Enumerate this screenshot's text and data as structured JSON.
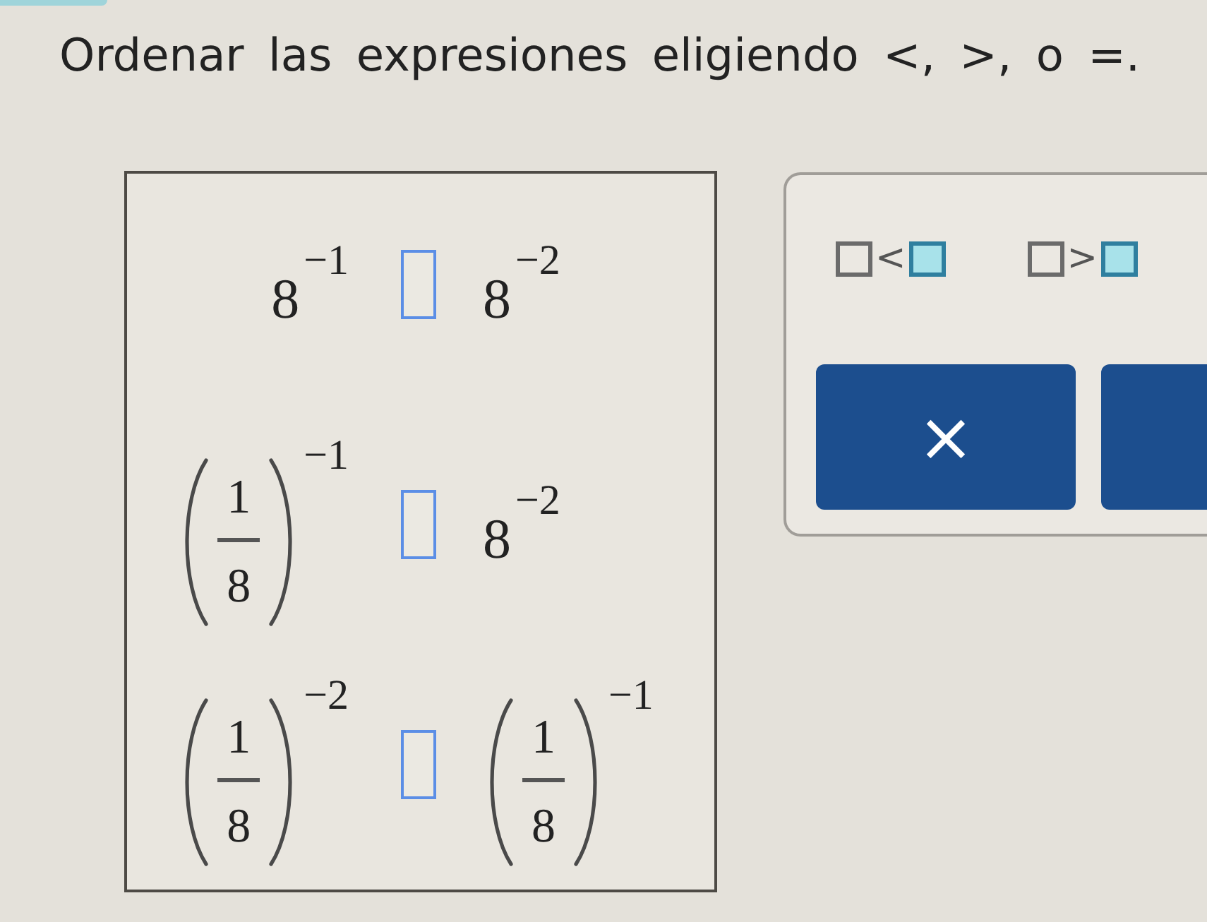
{
  "instruction": "Ordenar las expresiones eligiendo <, >, o =.",
  "comparisons": [
    {
      "left": {
        "kind": "power",
        "base": "8",
        "exponent": "−1"
      },
      "right": {
        "kind": "power",
        "base": "8",
        "exponent": "−2"
      }
    },
    {
      "left": {
        "kind": "fraction_power",
        "numerator": "1",
        "denominator": "8",
        "exponent": "−1"
      },
      "right": {
        "kind": "power",
        "base": "8",
        "exponent": "−2"
      }
    },
    {
      "left": {
        "kind": "fraction_power",
        "numerator": "1",
        "denominator": "8",
        "exponent": "−2"
      },
      "right": {
        "kind": "fraction_power",
        "numerator": "1",
        "denominator": "8",
        "exponent": "−1"
      }
    }
  ],
  "palette": {
    "templates": [
      {
        "symbol": "<"
      },
      {
        "symbol": ">"
      }
    ],
    "buttons": [
      {
        "kind": "clear",
        "label": "×"
      },
      {
        "kind": "partial"
      }
    ]
  }
}
